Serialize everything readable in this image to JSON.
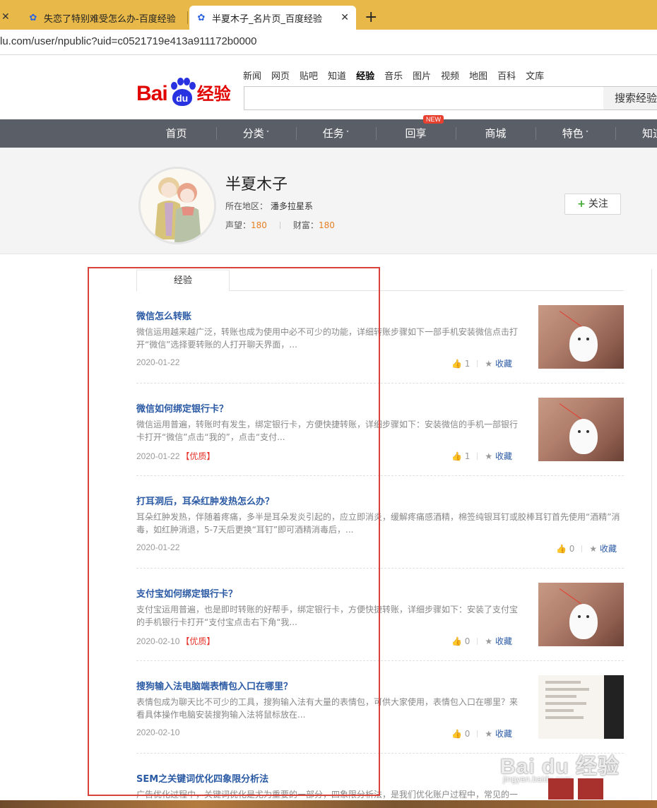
{
  "browser": {
    "tabs": [
      {
        "title": "失恋了特别难受怎么办-百度经验"
      },
      {
        "title": "半夏木子_名片页_百度经验"
      }
    ],
    "new_tab": "+",
    "close": "✕",
    "url": "lu.com/user/npublic?uid=c0521719e413a911172b0000"
  },
  "header": {
    "logo_bai": "Bai",
    "logo_du": "du",
    "logo_jingyan": "经验",
    "topnav": [
      "新闻",
      "网页",
      "贴吧",
      "知道",
      "经验",
      "音乐",
      "图片",
      "视频",
      "地图",
      "百科",
      "文库"
    ],
    "search_button": "搜索经验"
  },
  "navbar": {
    "items": [
      "首页",
      "分类",
      "任务",
      "回享",
      "商城",
      "特色",
      "知道"
    ],
    "caret": "˅",
    "new_badge": "NEW"
  },
  "profile": {
    "name": "半夏木子",
    "region_label": "所在地区：",
    "region": "潘多拉星系",
    "reputation_label": "声望：",
    "reputation": "180",
    "wealth_label": "财富：",
    "wealth": "180",
    "follow_plus": "+",
    "follow": "关注"
  },
  "content": {
    "tab": "经验",
    "fav_label": "收藏",
    "articles": [
      {
        "title": "微信怎么转账",
        "desc1": "微信运用越来越广泛，转账也成为使用中必不可少的功能，详细转账步骤如下一部手机安装微信点击打",
        "desc2": "开“微信”选择要转账的人打开聊天界面，...",
        "date": "2020-01-22",
        "quality": "",
        "likes": "1"
      },
      {
        "title": "微信如何绑定银行卡？",
        "desc1": "微信运用普遍，转账时有发生，绑定银行卡，方便快捷转账，详细步骤如下：安装微信的手机一部银行",
        "desc2": "卡打开“微信”点击“我的”，点击“支付...",
        "date": "2020-01-22",
        "quality": "【优质】",
        "likes": "1"
      },
      {
        "title": "打耳洞后，耳朵红肿发热怎么办？",
        "desc1": "耳朵红肿发热，伴随着疼痛，多半是耳朵发炎引起的，应立即消炎，缓解疼痛感酒精，棉签纯银耳钉或胶棒耳钉首先使用“酒精”消",
        "desc2": "毒，如红肿消退，5-7天后更换“耳钉”即可酒精消毒后，...",
        "date": "2020-01-22",
        "quality": "",
        "likes": "0"
      },
      {
        "title": "支付宝如何绑定银行卡？",
        "desc1": "支付宝运用普遍，也是即时转账的好帮手，绑定银行卡，方便快捷转账，详细步骤如下：安装了支付宝",
        "desc2": "的手机银行卡打开“支付宝点击右下角“我...",
        "date": "2020-02-10",
        "quality": "【优质】",
        "likes": "0"
      },
      {
        "title": "搜狗输入法电脑端表情包入口在哪里？",
        "desc1": "表情包成为聊天比不可少的工具，搜狗输入法有大量的表情包，可供大家使用，表情包入口在哪里？来",
        "desc2": "看具体操作电脑安装搜狗输入法将鼠标放在...",
        "date": "2020-02-10",
        "quality": "",
        "likes": "0"
      },
      {
        "title": "SEM之关键词优化四象限分析法",
        "desc1": "广告优化过程中，关键词优化是尤为重要的一部分，四象限分析法，是我们优化账户过程中，常见的一",
        "desc2": "",
        "date": "",
        "quality": "",
        "likes": ""
      }
    ]
  },
  "watermark": {
    "text": "Bai du 经验",
    "url": "jingyan.baidu.com"
  }
}
